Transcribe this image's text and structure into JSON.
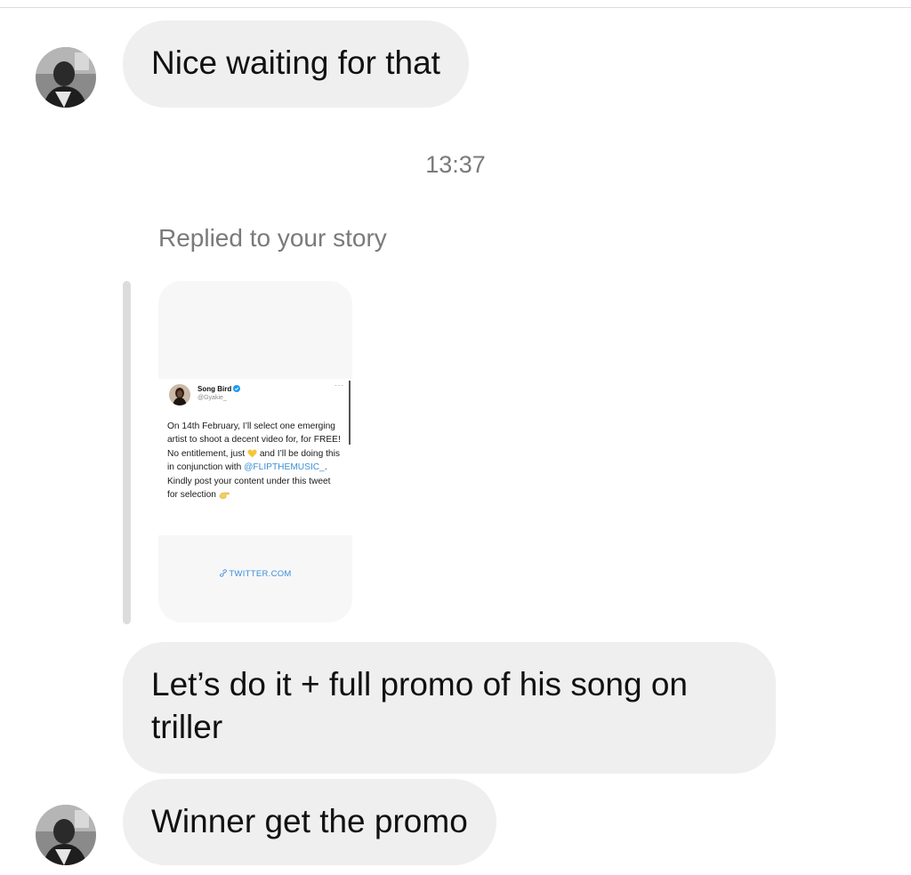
{
  "messages": [
    {
      "text": "Nice waiting for that"
    },
    {
      "text": "Let’s do it + full promo of his song on triller"
    },
    {
      "text": "Winner get the promo"
    }
  ],
  "timestamp": "13:37",
  "reply_label": "Replied to your story",
  "story": {
    "tweet": {
      "name": "Song Bird",
      "handle": "@Gyakie_",
      "more": "···",
      "text_1": "On 14th February, I’ll select one emerging artist to shoot a decent video for, for FREE! No entitlement, just",
      "text_2": "and I’ll be doing this in conjunction with",
      "mention": "@FLIPTHEMUSIC_",
      "text_3": ". Kindly post your content under this tweet for selection",
      "verified_color": "#1d9bf0",
      "heart_emoji": "yellow-heart-icon",
      "hand_emoji": "pointing-hand-icon"
    },
    "link_text": "TWITTER.COM"
  },
  "colors": {
    "bubble_bg": "#efefef",
    "meta_text": "#7a7a7a",
    "link": "#3a8fd8"
  }
}
